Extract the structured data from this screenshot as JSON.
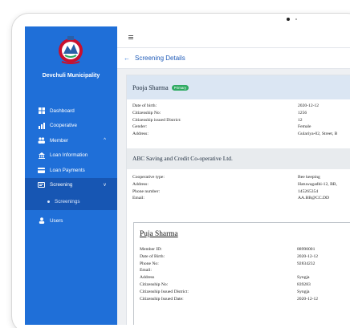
{
  "sidebar": {
    "org_name": "Devchuli Municipality",
    "items": [
      {
        "label": "Dashboard",
        "icon": "dashboard-icon"
      },
      {
        "label": "Cooperative",
        "icon": "chart-icon"
      },
      {
        "label": "Member",
        "icon": "people-icon",
        "chevron": "^"
      },
      {
        "label": "Loan Information",
        "icon": "bank-icon"
      },
      {
        "label": "Loan Payments",
        "icon": "card-icon"
      },
      {
        "label": "Screening",
        "icon": "screen-icon",
        "chevron": "v",
        "active": true
      }
    ],
    "sub_items": [
      {
        "label": "Screenings"
      }
    ],
    "bottom_items": [
      {
        "label": "Users",
        "icon": "user-icon"
      }
    ]
  },
  "header": {
    "page_title": "Screening Details",
    "back_icon": "←"
  },
  "person": {
    "name": "Pooja Sharma",
    "badge": "Primary",
    "fields": [
      {
        "label": "Date of birth:",
        "value": "2020-12-12"
      },
      {
        "label": "Citizenship No:",
        "value": "1256"
      },
      {
        "label": "Citizenship issued District:",
        "value": "12"
      },
      {
        "label": "Gender:",
        "value": "Female"
      },
      {
        "label": "Address:",
        "value": "Gulariya-02, Street, B"
      }
    ]
  },
  "cooperative": {
    "name": "ABC Saving and Credit Co-operative Ltd.",
    "fields": [
      {
        "label": "Cooperative type:",
        "value": "Bee keeping"
      },
      {
        "label": "Address:",
        "value": "Hatuwagadhi-12, BB,"
      },
      {
        "label": "Phone number:",
        "value": "145265354"
      },
      {
        "label": "Email:",
        "value": "AA.BB@CC.DD"
      }
    ]
  },
  "member": {
    "name": "Puja Sharma",
    "fields": [
      {
        "label": "Member ID:",
        "value": "88990001"
      },
      {
        "label": "Date of Birth:",
        "value": "2020-12-12"
      },
      {
        "label": "Phone No:",
        "value": "92834232"
      },
      {
        "label": "Email:",
        "value": ""
      },
      {
        "label": "Address",
        "value": "Syngja"
      },
      {
        "label": "Citizenship No:",
        "value": "839283"
      },
      {
        "label": "Citizenship Issued District:",
        "value": "Syngja"
      },
      {
        "label": "Citizenship Issued Date:",
        "value": "2020-12-12"
      }
    ]
  },
  "colors": {
    "sidebar": "#1f6fd8",
    "sidebar_active": "#1756b3",
    "badge": "#2faa62",
    "title": "#1f5bb8"
  }
}
